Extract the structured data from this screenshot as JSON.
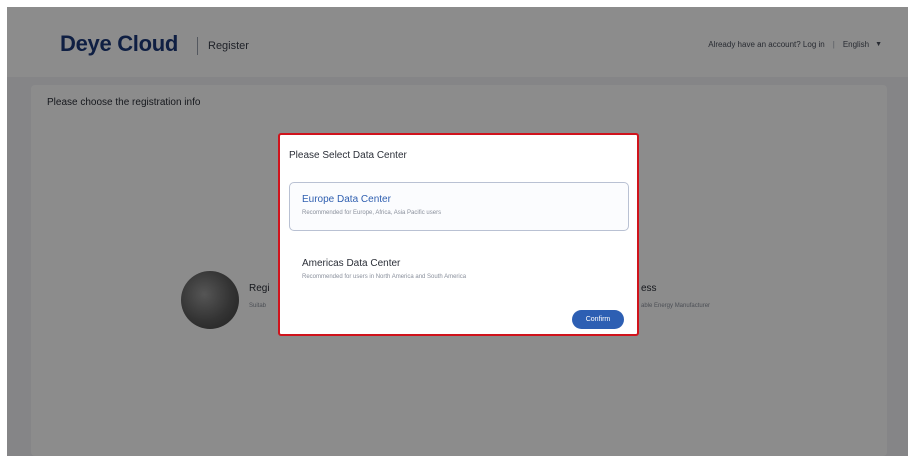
{
  "header": {
    "logo": "Deye Cloud",
    "page_label": "Register",
    "login_text": "Already have an account? Log in",
    "separator": "|",
    "language": "English"
  },
  "main": {
    "title": "Please choose the registration info",
    "cards": [
      {
        "title": "Regi",
        "subtitle": "Suitab"
      },
      {
        "title": "ess",
        "subtitle": "able Energy Manufacturer"
      }
    ]
  },
  "modal": {
    "title": "Please Select Data Center",
    "options": [
      {
        "title": "Europe Data Center",
        "subtitle": "Recommended for Europe, Africa, Asia Pacific users",
        "selected": true
      },
      {
        "title": "Americas Data Center",
        "subtitle": "Recommended for users in North America and South America",
        "selected": false
      }
    ],
    "confirm_label": "Confirm"
  },
  "colors": {
    "brand": "#1d3a7a",
    "accent": "#2d5fb3",
    "highlight_border": "#d0131c",
    "overlay": "rgba(0,0,0,0.45)"
  },
  "icons": {
    "language_caret": "caret-down-icon"
  }
}
